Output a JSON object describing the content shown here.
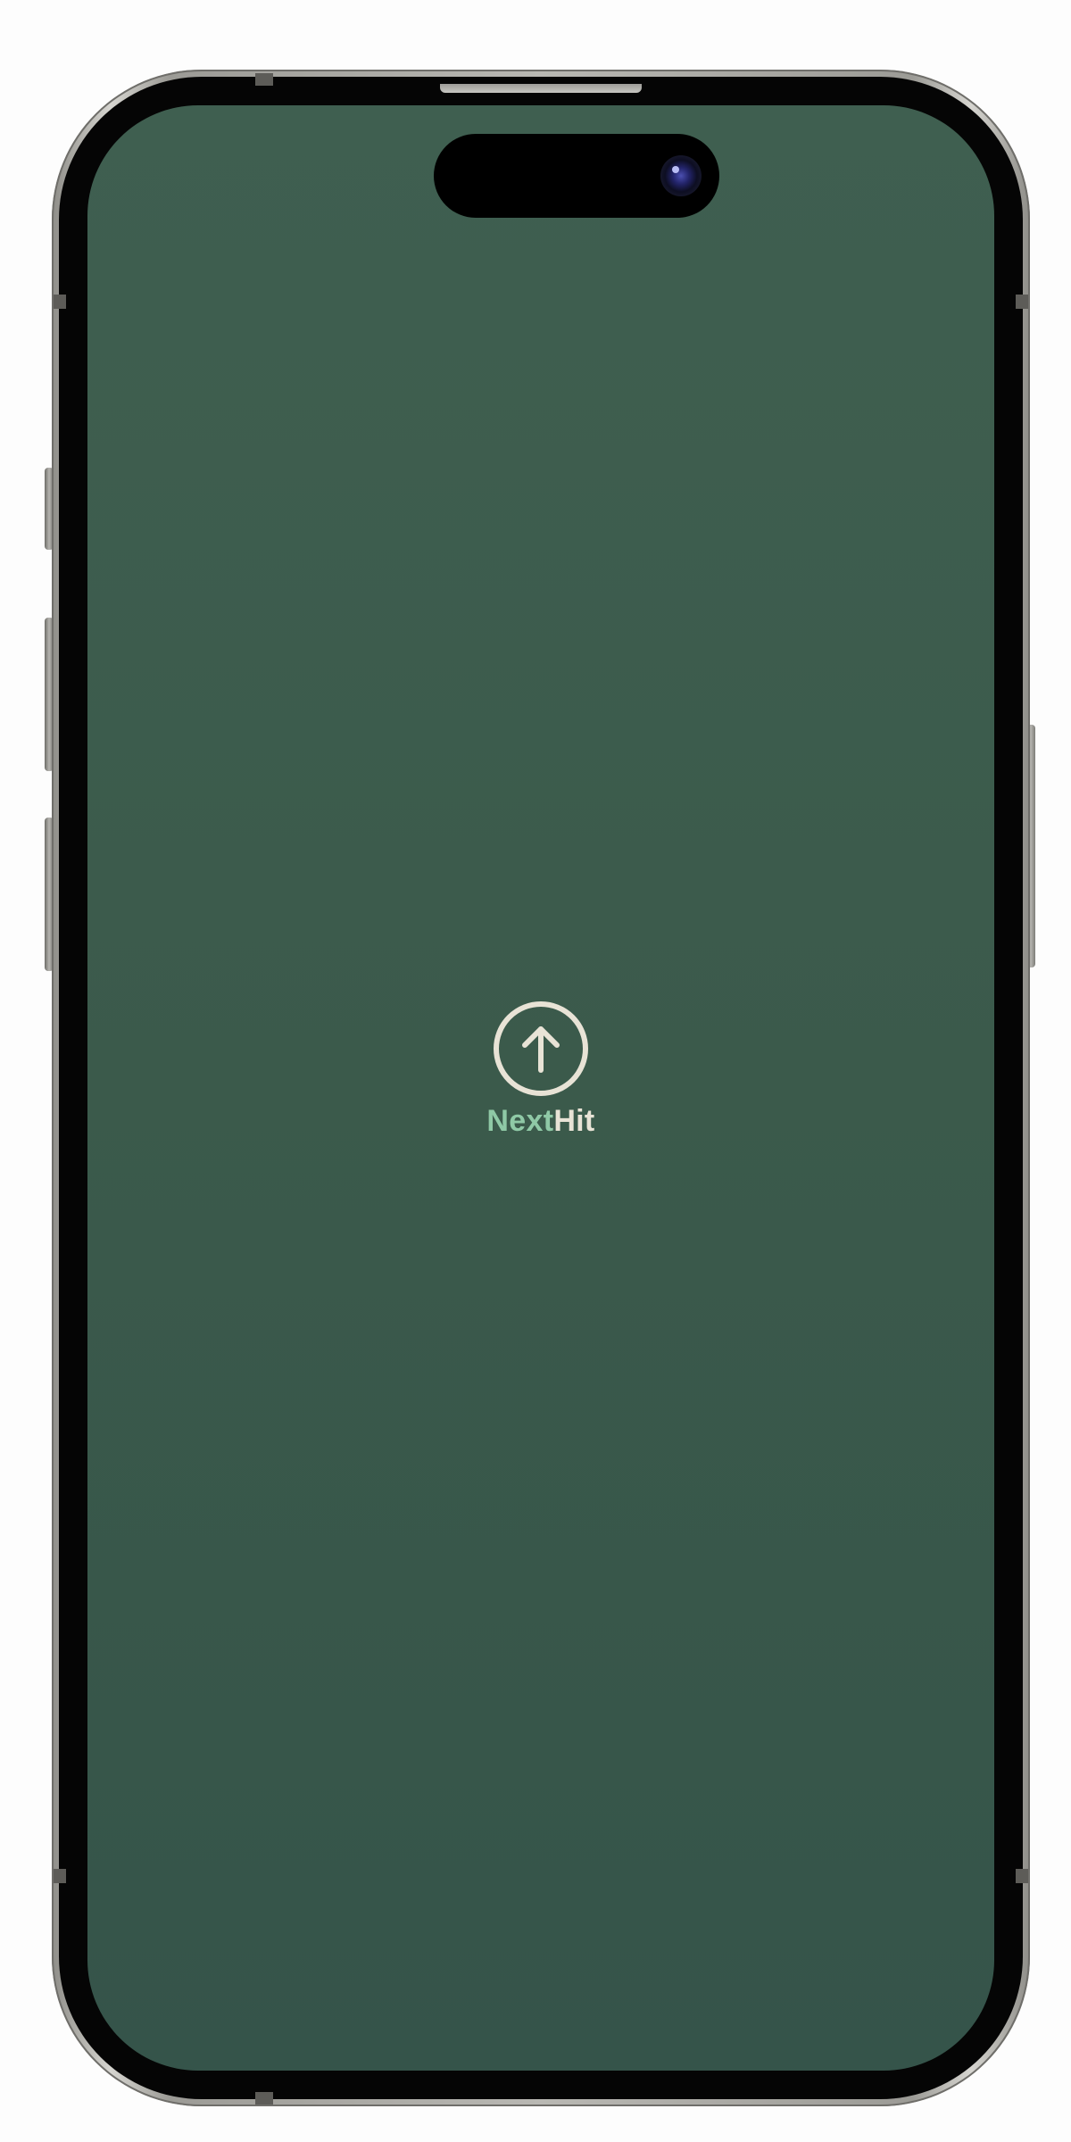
{
  "app": {
    "brand_name_part1": "Next",
    "brand_name_part2": "Hit"
  },
  "logo": {
    "icon": "arrow-up-circle-icon"
  },
  "colors": {
    "screen_background": "#3b5a4b",
    "brand_part1": "#8fc9a6",
    "brand_part2": "#e8e3d6",
    "logo_stroke": "#e8e3d6"
  }
}
